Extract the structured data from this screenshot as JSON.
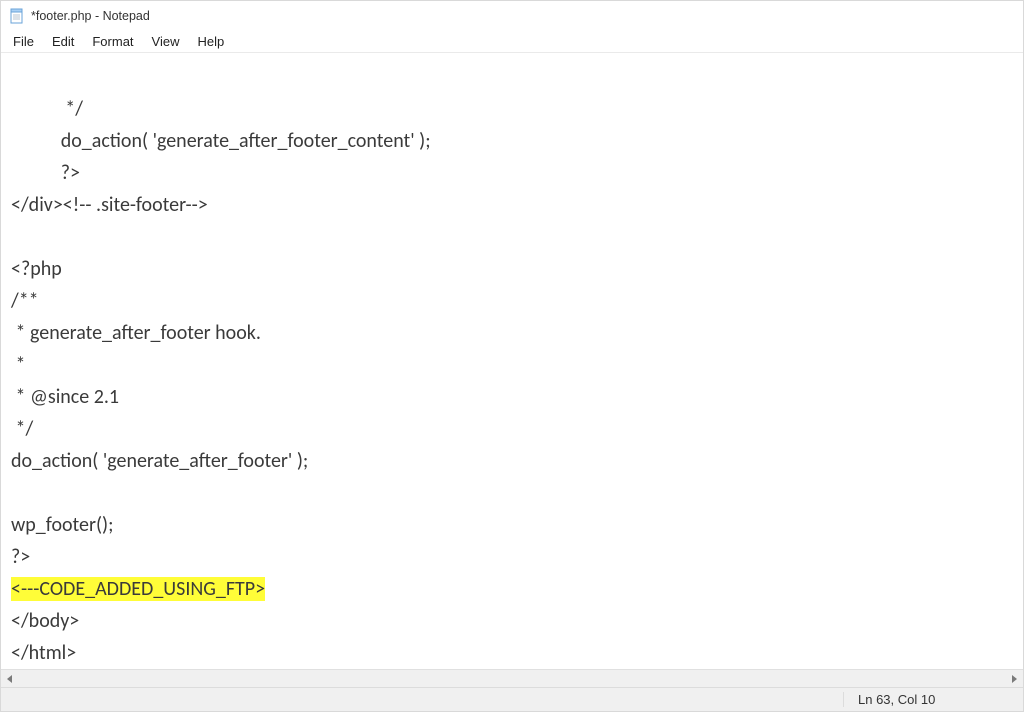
{
  "title": "*footer.php - Notepad",
  "menu": {
    "file": "File",
    "edit": "Edit",
    "format": "Format",
    "view": "View",
    "help": "Help"
  },
  "editor": {
    "l1": "            */",
    "l2": "           do_action( 'generate_after_footer_content' );",
    "l3": "           ?>",
    "l4": "</div><!-- .site-footer-->",
    "l5": "",
    "l6": "<?php",
    "l7": "/**",
    "l8": " * generate_after_footer hook.",
    "l9": " *",
    "l10": " * @since 2.1",
    "l11": " */",
    "l12": "do_action( 'generate_after_footer' );",
    "l13": "",
    "l14": "wp_footer();",
    "l15": "?>",
    "l16": "<---CODE_ADDED_USING_FTP>",
    "l17": "</body>",
    "l18": "</html>"
  },
  "status": {
    "pos": "Ln 63, Col 10"
  }
}
